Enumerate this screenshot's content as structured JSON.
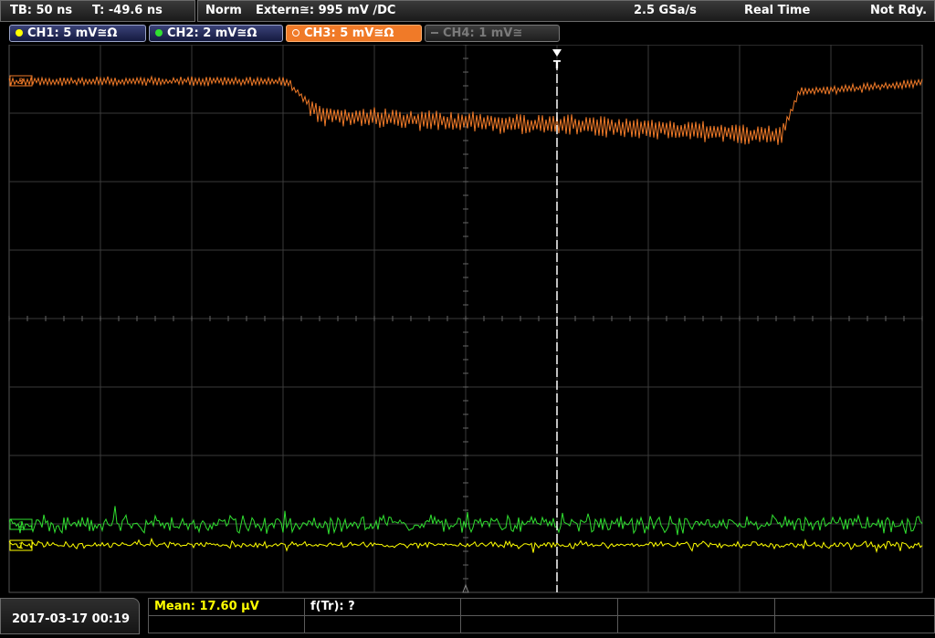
{
  "topbar": {
    "timebase": "TB: 50 ns",
    "trigger_time": "T: -49.6 ns",
    "trigger_mode": "Norm",
    "trigger_source": "Extern≅: 995 mV ∕DC",
    "sample_rate": "2.5 GSa/s",
    "acq_mode": "Real Time",
    "status": "Not Rdy."
  },
  "channels": [
    {
      "label": "CH1: 5 mV≅Ω",
      "color": "#ffff00",
      "active": true
    },
    {
      "label": "CH2: 2 mV≅Ω",
      "color": "#30e030",
      "active": true
    },
    {
      "label": "CH3: 5 mV≅Ω",
      "color": "#f07a28",
      "active": true,
      "selected": true
    },
    {
      "label": "CH4: 1 mV≅",
      "color": "#777777",
      "active": false
    }
  ],
  "markers": {
    "trigger": "T",
    "ch3_marker": "3",
    "ch2_marker": "2",
    "ch1_marker": "1"
  },
  "bottom": {
    "datetime": "2017-03-17 00:19",
    "measurement1": "Mean: 17.60 µV",
    "measurement2": "f(Tr): ?"
  },
  "colors": {
    "ch1": "#ffff00",
    "ch2": "#30e030",
    "ch3": "#f07a28",
    "grid": "#3c3c3c",
    "accent": "#f07a28"
  }
}
